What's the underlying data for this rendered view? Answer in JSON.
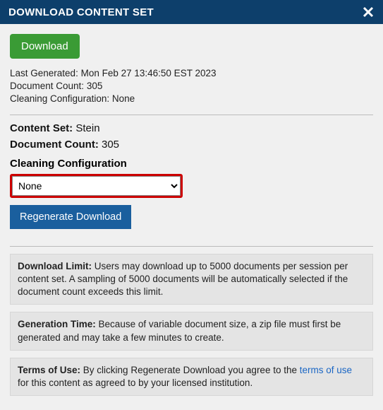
{
  "header": {
    "title": "DOWNLOAD CONTENT SET"
  },
  "buttons": {
    "download": "Download",
    "regenerate": "Regenerate Download"
  },
  "meta": {
    "last_generated_label": "Last Generated:",
    "last_generated_value": "Mon Feb 27 13:46:50 EST 2023",
    "doc_count_label": "Document Count:",
    "doc_count_value": "305",
    "cleaning_label": "Cleaning Configuration:",
    "cleaning_value": "None"
  },
  "fields": {
    "content_set_label": "Content Set:",
    "content_set_value": "Stein",
    "doc_count_label": "Document Count:",
    "doc_count_value": "305",
    "cc_label": "Cleaning Configuration",
    "cc_selected": "None"
  },
  "notices": {
    "dl_title": "Download Limit:",
    "dl_text": "Users may download up to 5000 documents per session per content set. A sampling of 5000 documents will be automatically selected if the document count exceeds this limit.",
    "gt_title": "Generation Time:",
    "gt_text": "Because of variable document size, a zip file must first be generated and may take a few minutes to create.",
    "tou_title": "Terms of Use:",
    "tou_pre": "By clicking Regenerate Download you agree to the ",
    "tou_link": "terms of use",
    "tou_post": " for this content as agreed to by your licensed institution."
  }
}
